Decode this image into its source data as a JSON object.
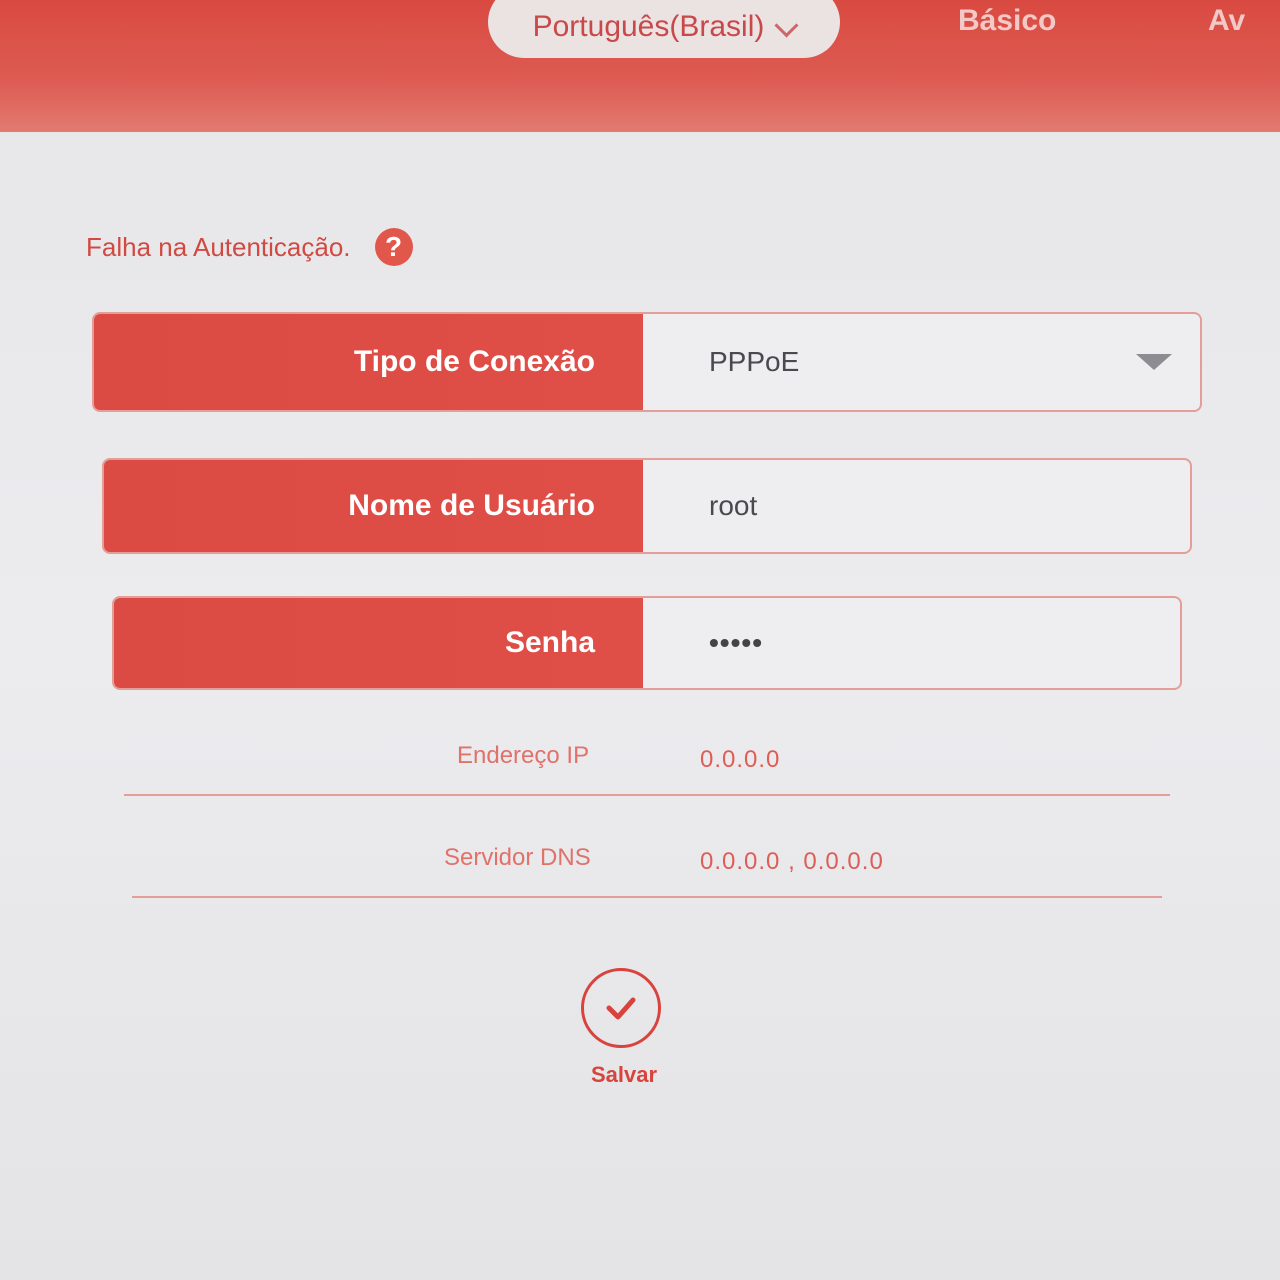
{
  "header": {
    "language": "Português(Brasil)",
    "nav_basic": "Básico",
    "nav_advanced_partial": "Av"
  },
  "status": {
    "message": "Falha na Autenticação.",
    "help_icon": "question-mark-icon"
  },
  "form": {
    "connection_type": {
      "label": "Tipo de Conexão",
      "value": "PPPoE"
    },
    "username": {
      "label": "Nome de Usuário",
      "value": "root"
    },
    "password": {
      "label": "Senha",
      "value": "•••••"
    }
  },
  "info": {
    "ip": {
      "label": "Endereço IP",
      "value": "0.0.0.0"
    },
    "dns": {
      "label": "Servidor DNS",
      "value": "0.0.0.0 , 0.0.0.0"
    }
  },
  "actions": {
    "save_label": "Salvar",
    "save_icon": "check-icon"
  },
  "colors": {
    "brand_red": "#dc4a44",
    "header_red": "#d94a41",
    "text_red": "#d14a42"
  }
}
